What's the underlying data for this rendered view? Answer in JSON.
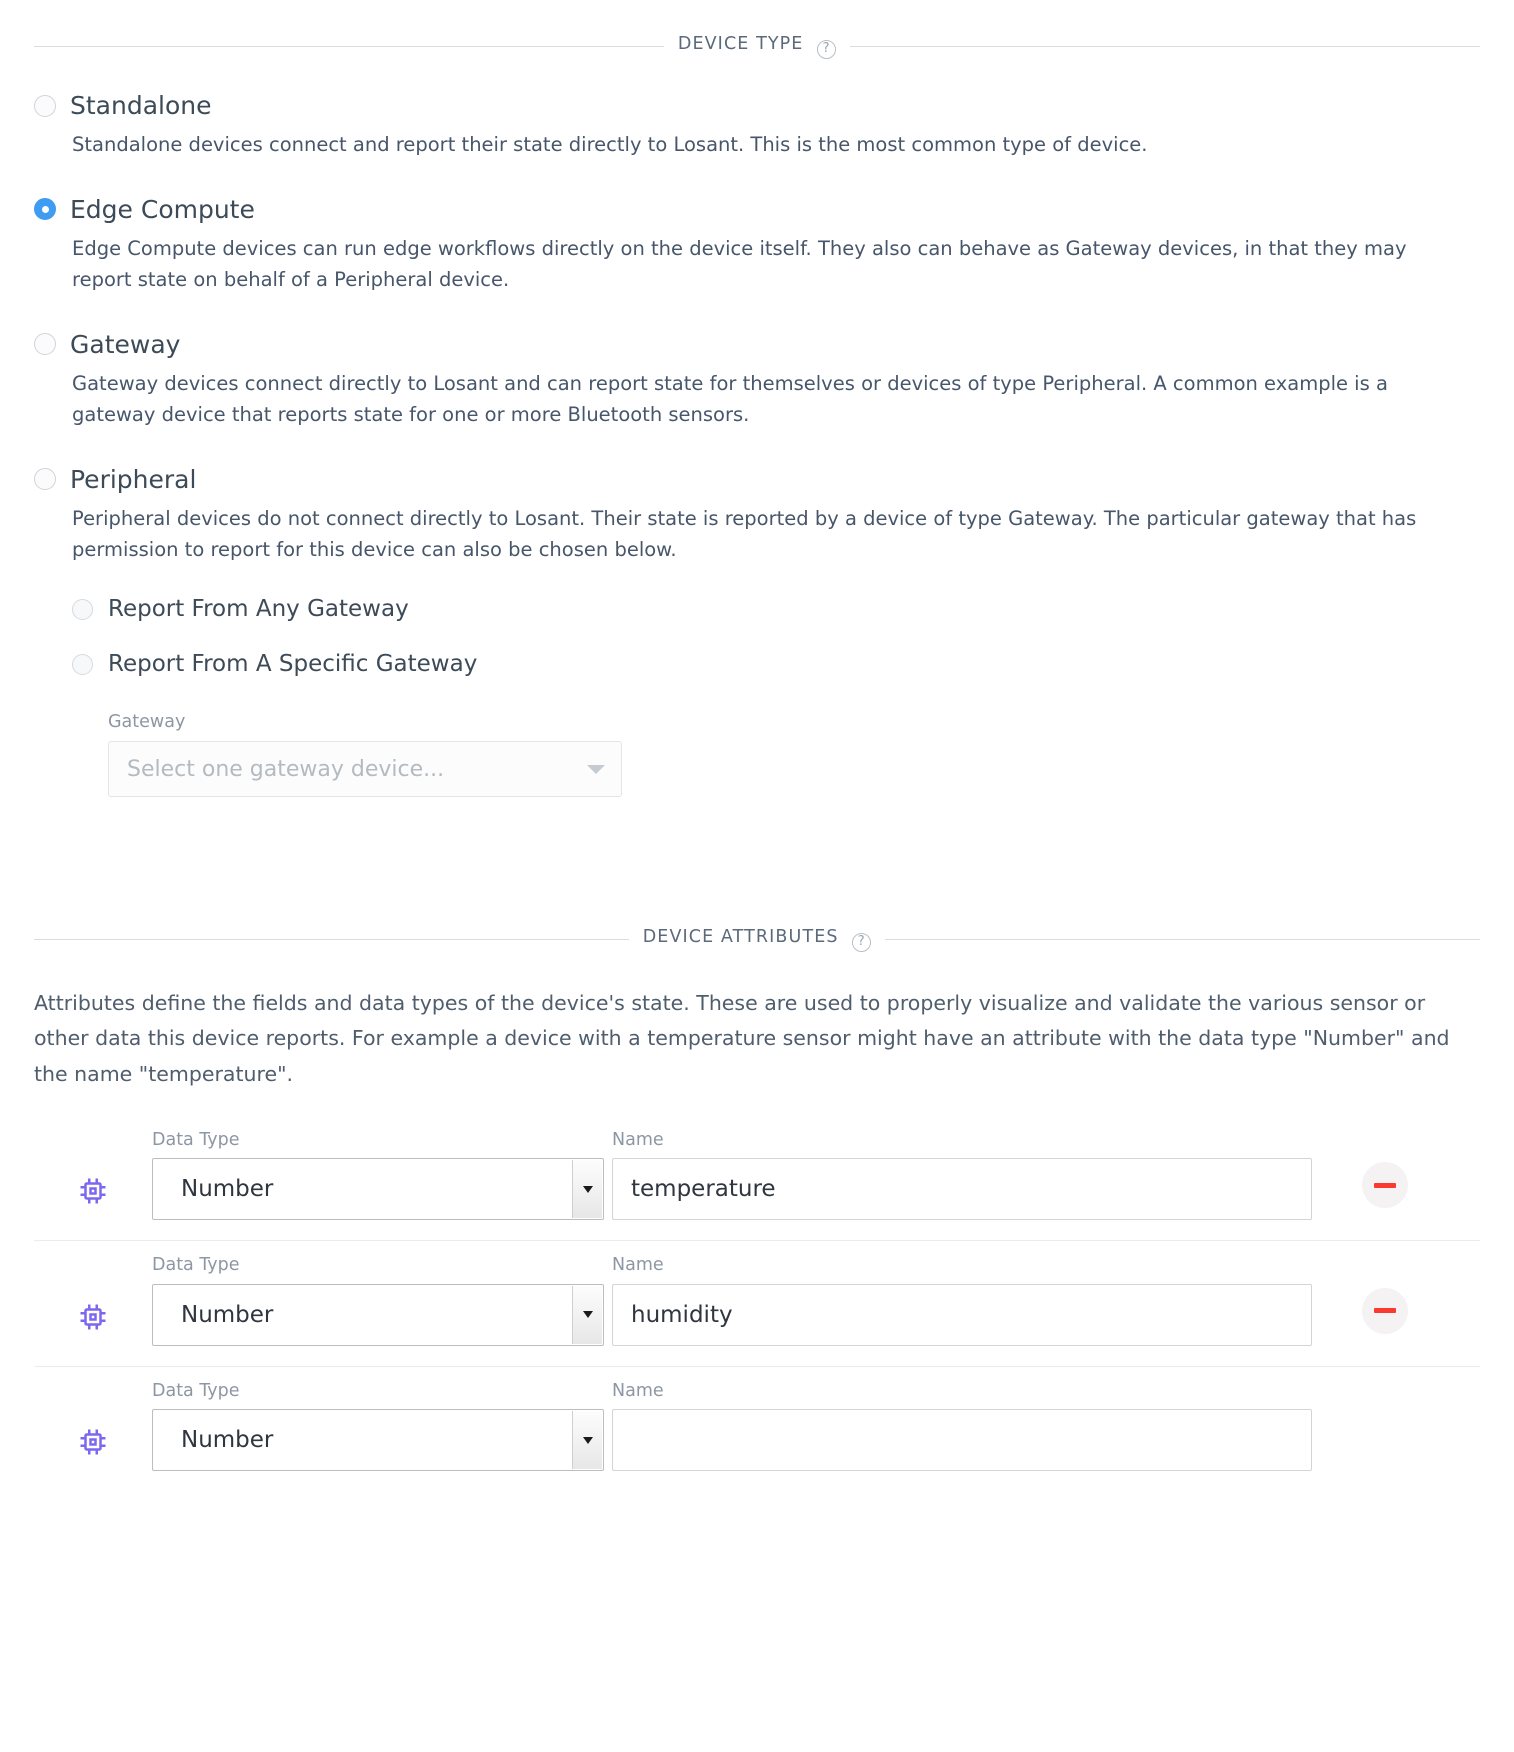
{
  "device_type_section": {
    "title": "DEVICE TYPE",
    "help_icon": "question-circle-icon",
    "options": [
      {
        "label": "Standalone",
        "selected": false,
        "description": "Standalone devices connect and report their state directly to Losant. This is the most common type of device."
      },
      {
        "label": "Edge Compute",
        "selected": true,
        "description": "Edge Compute devices can run edge workflows directly on the device itself. They also can behave as Gateway devices, in that they may report state on behalf of a Peripheral device."
      },
      {
        "label": "Gateway",
        "selected": false,
        "description": "Gateway devices connect directly to Losant and can report state for themselves or devices of type Peripheral. A common example is a gateway device that reports state for one or more Bluetooth sensors."
      },
      {
        "label": "Peripheral",
        "selected": false,
        "description": "Peripheral devices do not connect directly to Losant. Their state is reported by a device of type Gateway. The particular gateway that has permission to report for this device can also be chosen below."
      }
    ],
    "sub_options": [
      {
        "label": "Report From Any Gateway",
        "selected": false
      },
      {
        "label": "Report From A Specific Gateway",
        "selected": false
      }
    ],
    "gateway_field": {
      "label": "Gateway",
      "placeholder": "Select one gateway device...",
      "value": "",
      "caret_icon": "chevron-down-icon"
    }
  },
  "device_attributes_section": {
    "title": "DEVICE ATTRIBUTES",
    "help_icon": "question-circle-icon",
    "intro": "Attributes define the fields and data types of the device's state. These are used to properly visualize and validate the various sensor or other data this device reports. For example a device with a temperature sensor might have an attribute with the data type \"Number\" and the name \"temperature\".",
    "column_labels": {
      "data_type": "Data Type",
      "name": "Name"
    },
    "rows": [
      {
        "icon": "microchip-icon",
        "data_type": "Number",
        "name": "temperature",
        "name_placeholder": "",
        "remove_label": "−",
        "has_remove": true
      },
      {
        "icon": "microchip-icon",
        "data_type": "Number",
        "name": "humidity",
        "name_placeholder": "",
        "remove_label": "−",
        "has_remove": true
      },
      {
        "icon": "microchip-icon",
        "data_type": "Number",
        "name": "",
        "name_placeholder": "",
        "remove_label": "−",
        "has_remove": false
      }
    ]
  },
  "colors": {
    "radio_selected": "#3f9cf1",
    "chip_icon": "#7b68ee",
    "remove_minus": "#f93a2f",
    "heading_text": "#5b6a7a",
    "body_text": "#47566a",
    "muted_label": "#8d97a3"
  }
}
